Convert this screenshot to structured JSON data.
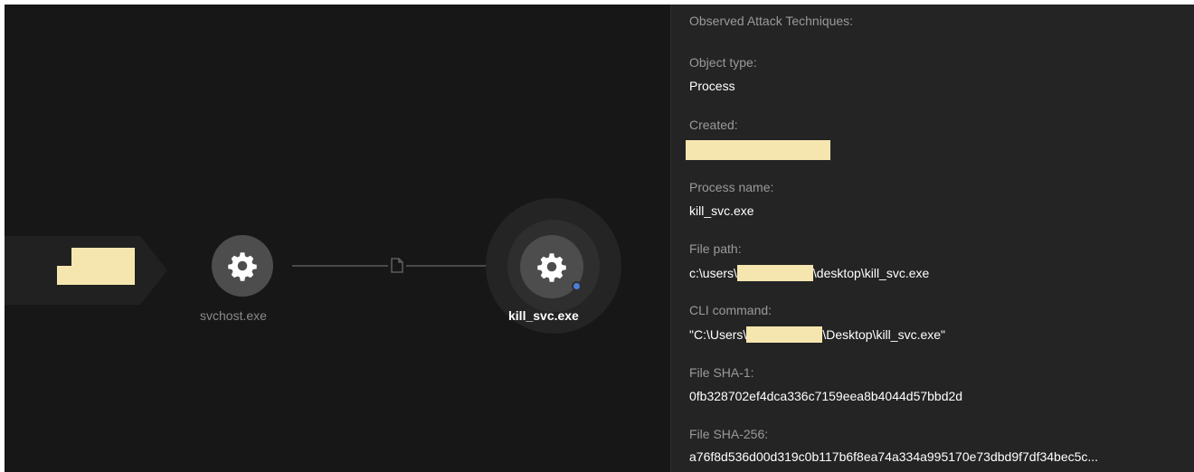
{
  "graph": {
    "nodes": [
      {
        "name": "svchost.exe",
        "icon": "gear-icon"
      },
      {
        "name": "kill_svc.exe",
        "icon": "gear-icon",
        "selected": true
      }
    ],
    "edge_icon": "file-icon",
    "colors": {
      "canvas": "#171717",
      "node": "#4d4d4d",
      "edge": "#5a5a5a",
      "status_dot": "#4a7fd8",
      "redaction": "#f5e6b0"
    }
  },
  "details": {
    "heading": "Observed Attack Techniques:",
    "object_type": {
      "label": "Object type:",
      "value": "Process"
    },
    "created": {
      "label": "Created:"
    },
    "process_name": {
      "label": "Process name:",
      "value": "kill_svc.exe"
    },
    "file_path": {
      "label": "File path:",
      "prefix": "c:\\users\\",
      "suffix": "\\desktop\\kill_svc.exe"
    },
    "cli_command": {
      "label": "CLI command:",
      "prefix": "\"C:\\Users\\",
      "suffix": "\\Desktop\\kill_svc.exe\""
    },
    "sha1": {
      "label": "File SHA-1:",
      "value": "0fb328702ef4dca336c7159eea8b4044d57bbd2d"
    },
    "sha256": {
      "label": "File SHA-256:",
      "value": "a76f8d536d00d319c0b117b6f8ea74a334a995170e73dbd9f7df34bec5c..."
    },
    "colors": {
      "panel": "#242424",
      "label": "#9a9a9a",
      "value": "#ffffff"
    }
  }
}
